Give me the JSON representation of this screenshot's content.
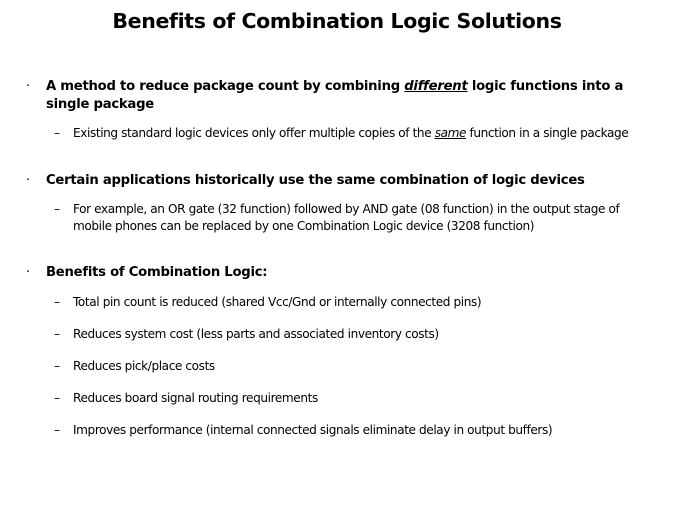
{
  "slide": {
    "title": "Benefits of Combination Logic Solutions",
    "background_color": "#ffffff",
    "text_color": "#000000",
    "bullet_marker_level1": "·",
    "bullet_marker_level2": "–",
    "bullets": [
      {
        "level": 1,
        "text_before_emphasis": "A method to reduce package count by combining ",
        "emphasis": "different",
        "text_after_emphasis": " logic functions into a single package",
        "full_text": "A method to reduce package count by combining different logic functions into a single package",
        "emphasis_style": "bold-italic-underline"
      },
      {
        "level": 2,
        "text_before_emphasis": "Existing standard logic devices only offer multiple copies of the ",
        "emphasis": "same",
        "text_after_emphasis": " function in a single package",
        "full_text": "Existing standard logic devices only offer multiple copies of the same function in a single package",
        "emphasis_style": "italic-underline"
      },
      {
        "level": 1,
        "full_text": "Certain applications historically use the same combination of logic devices"
      },
      {
        "level": 2,
        "full_text": "For example, an OR gate (32 function) followed by AND gate (08 function) in the output stage of mobile phones can be replaced by one Combination Logic device (3208 function)"
      },
      {
        "level": 1,
        "full_text": "Benefits of Combination Logic:"
      },
      {
        "level": 2,
        "full_text": "Total pin count is reduced (shared Vcc/Gnd or internally connected pins)"
      },
      {
        "level": 2,
        "full_text": "Reduces system cost (less parts and associated inventory costs)"
      },
      {
        "level": 2,
        "full_text": "Reduces pick/place costs"
      },
      {
        "level": 2,
        "full_text": "Reduces board signal routing requirements"
      },
      {
        "level": 2,
        "full_text": "Improves performance (internal connected signals eliminate delay in output buffers)"
      }
    ]
  }
}
